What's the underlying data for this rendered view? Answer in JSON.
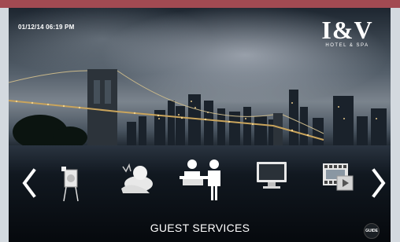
{
  "status": {
    "timestamp": "01/12/14 06:19 PM"
  },
  "brand": {
    "name": "I&V",
    "tagline": "HOTEL & SPA"
  },
  "carousel": {
    "items": [
      {
        "icon": "room-service-icon"
      },
      {
        "icon": "spa-icon"
      },
      {
        "icon": "guest-services-icon"
      },
      {
        "icon": "tv-icon"
      },
      {
        "icon": "movies-icon"
      }
    ],
    "selected_label": "GUEST SERVICES"
  },
  "guide": {
    "label": "GUIDE"
  },
  "colors": {
    "top_bar": "#a24a52",
    "text": "#ffffff"
  }
}
